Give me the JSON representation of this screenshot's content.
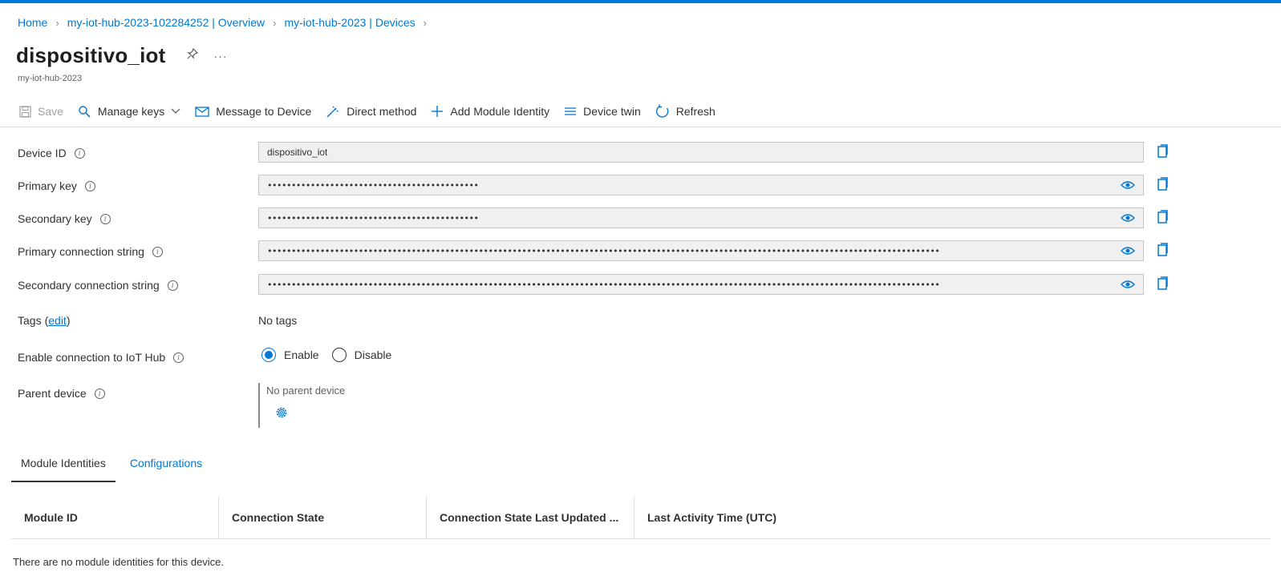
{
  "breadcrumb": [
    "Home",
    "my-iot-hub-2023-102284252 | Overview",
    "my-iot-hub-2023 | Devices"
  ],
  "title": "dispositivo_iot",
  "subtitle": "my-iot-hub-2023",
  "toolbar": {
    "save": "Save",
    "manage_keys": "Manage keys",
    "message_to_device": "Message to Device",
    "direct_method": "Direct method",
    "add_module_identity": "Add Module Identity",
    "device_twin": "Device twin",
    "refresh": "Refresh"
  },
  "fields": {
    "device_id": {
      "label": "Device ID",
      "value": "dispositivo_iot"
    },
    "primary_key": {
      "label": "Primary key",
      "value": "••••••••••••••••••••••••••••••••••••••••••••"
    },
    "secondary_key": {
      "label": "Secondary key",
      "value": "••••••••••••••••••••••••••••••••••••••••••••"
    },
    "primary_conn": {
      "label": "Primary connection string",
      "value": "••••••••••••••••••••••••••••••••••••••••••••••••••••••••••••••••••••••••••••••••••••••••••••••••••••••••••••••••••••••••••••••••••••••••••••"
    },
    "secondary_conn": {
      "label": "Secondary connection string",
      "value": "••••••••••••••••••••••••••••••••••••••••••••••••••••••••••••••••••••••••••••••••••••••••••••••••••••••••••••••••••••••••••••••••••••••••••••"
    }
  },
  "tags": {
    "label": "Tags",
    "edit": "edit",
    "value": "No tags"
  },
  "connection": {
    "label": "Enable connection to IoT Hub",
    "enable": "Enable",
    "disable": "Disable",
    "selected": "Enable"
  },
  "parent": {
    "label": "Parent device",
    "value": "No parent device"
  },
  "tabs": [
    "Module Identities",
    "Configurations"
  ],
  "table": {
    "headers": [
      "Module ID",
      "Connection State",
      "Connection State Last Updated ...",
      "Last Activity Time (UTC)"
    ],
    "empty_message": "There are no module identities for this device."
  },
  "colors": {
    "accent": "#0078d4",
    "field_bg": "#f0f0f0",
    "text": "#323130"
  }
}
